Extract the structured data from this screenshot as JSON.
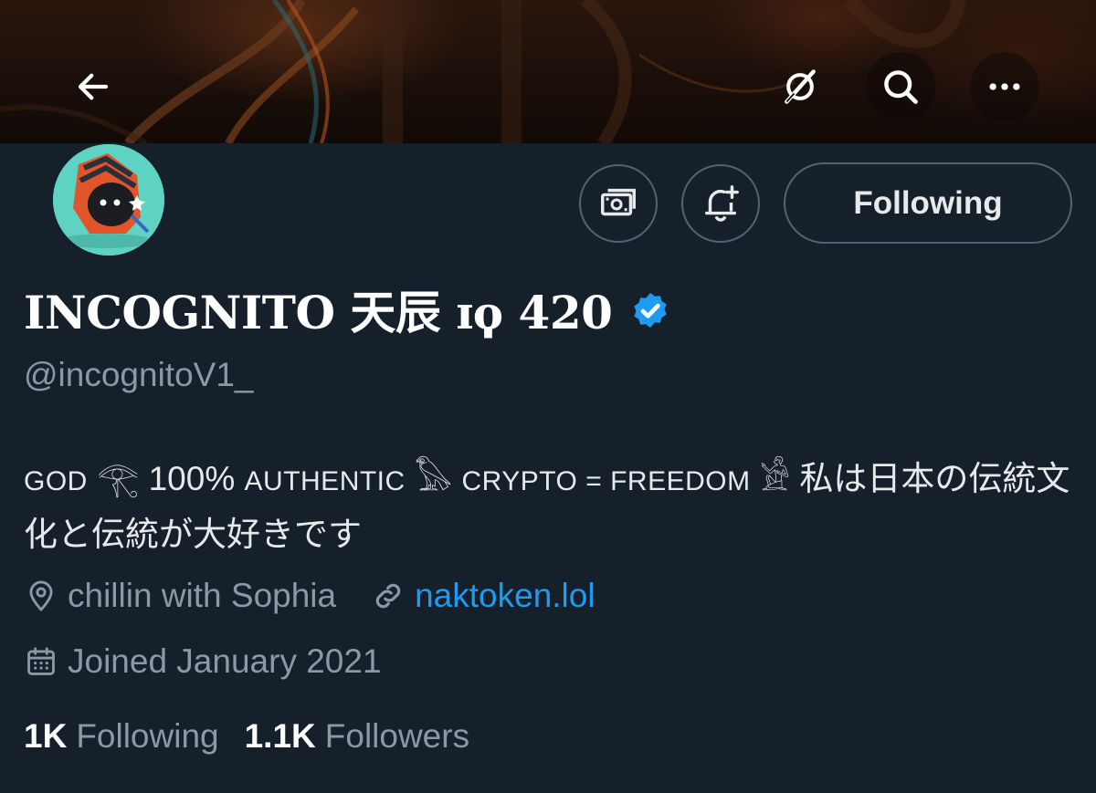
{
  "header": {
    "back_icon": "arrow-left-icon",
    "grok_icon": "grok-slash-icon",
    "search_icon": "search-icon",
    "more_icon": "more-dots-icon"
  },
  "profile": {
    "display_name": "INCOGNITO 天辰 ɪϙ 420",
    "verified": true,
    "verified_color": "#1d9bf0",
    "handle": "@incognitoV1_",
    "actions": {
      "tip_icon": "money-icon",
      "notify_icon": "bell-plus-icon",
      "follow_label": "Following"
    },
    "bio": {
      "p1": "GOD",
      "e1": "𓂀",
      "p2": "100%",
      "p3": "AUTHENTIC",
      "e2": "𓅃",
      "p4": "CRYPTO = FREEDOM",
      "e3": "𓀀",
      "p5": "私は日本の伝統文化と伝統が大好きです"
    },
    "location": "chillin with Sophia",
    "website": "naktoken.lol",
    "joined": "Joined January 2021",
    "following_count": "1K",
    "following_label": "Following",
    "followers_count": "1.1K",
    "followers_label": "Followers"
  },
  "colors": {
    "background": "#15202b",
    "text": "#e7e9ea",
    "secondary_text": "#8b98a5",
    "link": "#1d9bf0",
    "border": "#536471",
    "avatar_bg": "#5ed3c4"
  }
}
